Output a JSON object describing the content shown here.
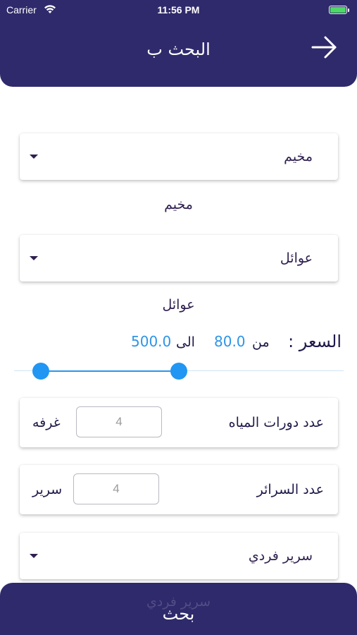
{
  "status_bar": {
    "carrier": "Carrier",
    "time": "11:56 PM"
  },
  "header": {
    "title": "البحث ب",
    "back_icon": "arrow-right-icon"
  },
  "category_dropdown": {
    "value": "مخيم",
    "caption": "مخيم"
  },
  "audience_dropdown": {
    "value": "عوائل",
    "caption": "عوائل"
  },
  "price": {
    "label": "السعر :",
    "from_label": "من",
    "min_value": "80.0",
    "to_label": "الى",
    "max_value": "500.0",
    "range_min": 80.0,
    "range_max": 500.0
  },
  "bathrooms": {
    "label": "عدد دورات المياه",
    "value": "4",
    "unit": "غرفه"
  },
  "beds": {
    "label": "عدد السرائر",
    "value": "4",
    "unit": "سرير"
  },
  "bed_type_dropdown": {
    "value": "سرير فردي",
    "caption": "سرير فردي"
  },
  "search_button": {
    "label": "بحث"
  },
  "colors": {
    "primary": "#2f2a6b",
    "accent": "#2196f3",
    "battery": "#4cd964"
  }
}
